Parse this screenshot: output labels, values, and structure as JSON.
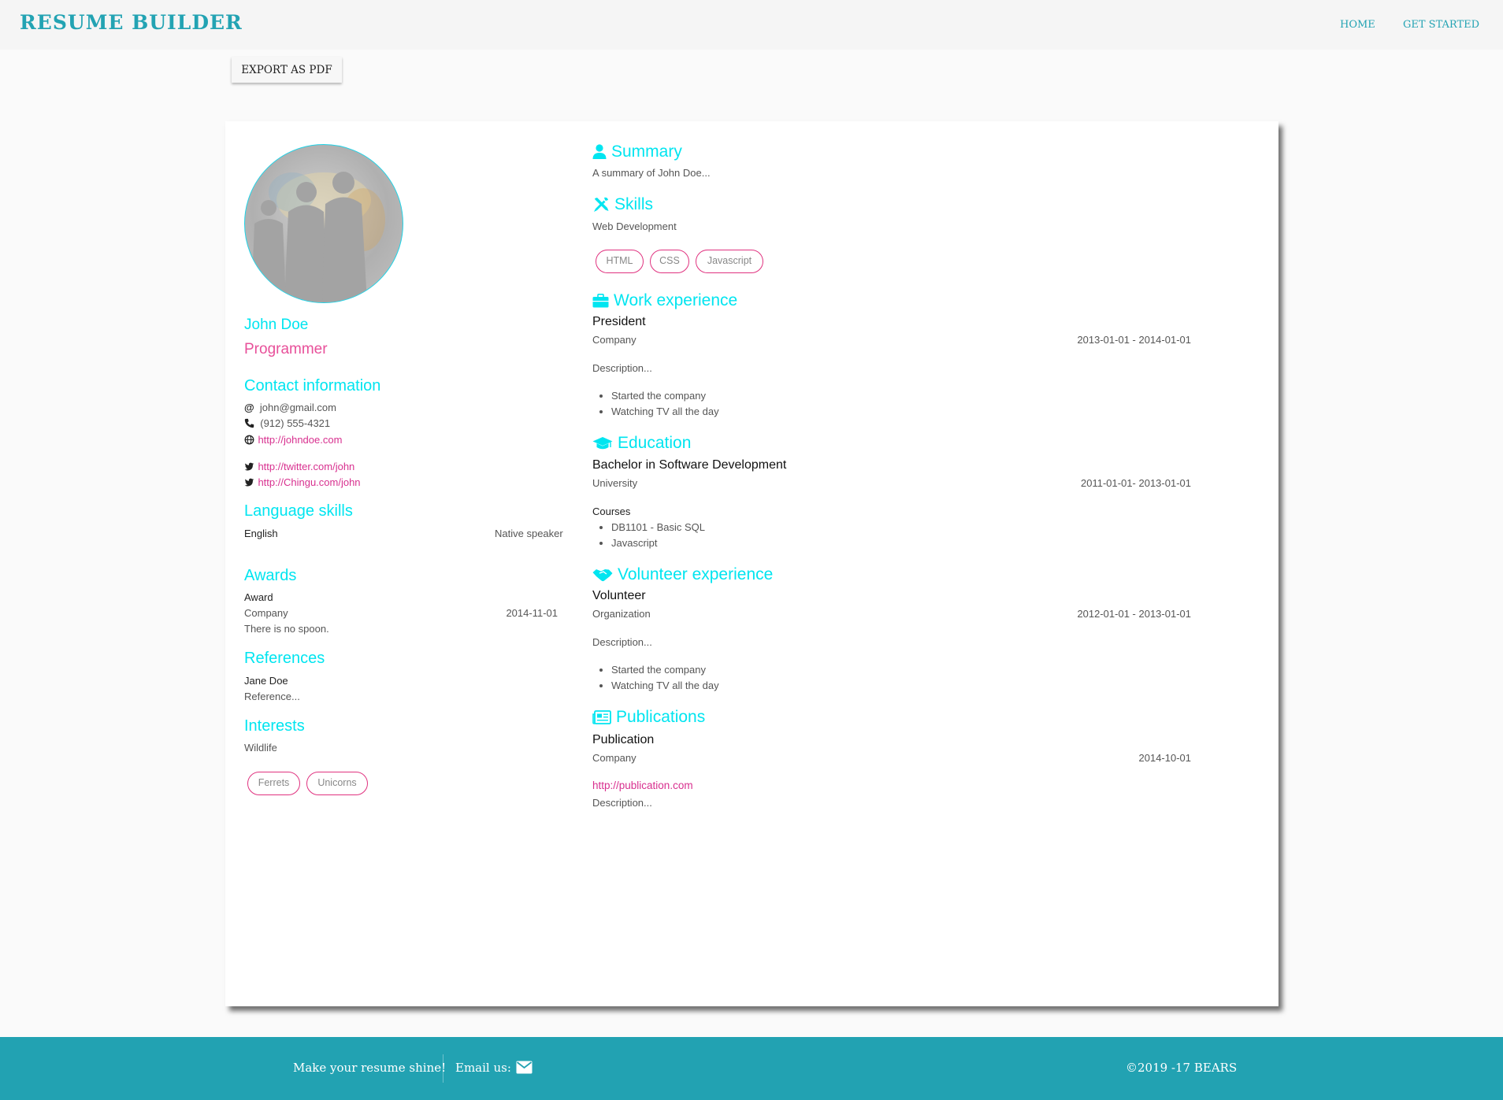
{
  "header": {
    "brand": "RESUME BUILDER",
    "nav": [
      {
        "label": "HOME"
      },
      {
        "label": "GET STARTED"
      }
    ]
  },
  "toolbar": {
    "export_label": "EXPORT AS PDF"
  },
  "resume": {
    "name": "John Doe",
    "role": "Programmer",
    "contact": {
      "heading": "Contact information",
      "email": "john@gmail.com",
      "phone": "(912) 555-4321",
      "website": "http://johndoe.com",
      "profiles": [
        "http://twitter.com/john",
        "http://Chingu.com/john"
      ]
    },
    "languages": {
      "heading": "Language skills",
      "items": [
        {
          "language": "English",
          "fluency": "Native speaker"
        }
      ]
    },
    "awards": {
      "heading": "Awards",
      "items": [
        {
          "title": "Award",
          "awarder": "Company",
          "date": "2014-11-01",
          "summary": "There is no spoon."
        }
      ]
    },
    "references": {
      "heading": "References",
      "items": [
        {
          "name": "Jane Doe",
          "reference": "Reference..."
        }
      ]
    },
    "interests": {
      "heading": "Interests",
      "items": [
        {
          "name": "Wildlife",
          "keywords": [
            "Ferrets",
            "Unicorns"
          ]
        }
      ]
    },
    "summary": {
      "heading": "Summary",
      "text": "A summary of John Doe..."
    },
    "skills": {
      "heading": "Skills",
      "items": [
        {
          "name": "Web Development",
          "keywords": [
            "HTML",
            "CSS",
            "Javascript"
          ]
        }
      ]
    },
    "work": {
      "heading": "Work experience",
      "items": [
        {
          "position": "President",
          "company": "Company",
          "dates": "2013-01-01 - 2014-01-01",
          "summary": "Description...",
          "highlights": [
            "Started the company",
            "Watching TV all the day"
          ]
        }
      ]
    },
    "education": {
      "heading": "Education",
      "items": [
        {
          "degree": "Bachelor in Software Development",
          "institution": "University",
          "dates": "2011-01-01- 2013-01-01",
          "courses_label": "Courses",
          "courses": [
            "DB1101 - Basic SQL",
            "Javascript"
          ]
        }
      ]
    },
    "volunteer": {
      "heading": "Volunteer experience",
      "items": [
        {
          "position": "Volunteer",
          "organization": "Organization",
          "dates": "2012-01-01 - 2013-01-01",
          "summary": "Description...",
          "highlights": [
            "Started the company",
            "Watching TV all the day"
          ]
        }
      ]
    },
    "publications": {
      "heading": "Publications",
      "items": [
        {
          "name": "Publication",
          "publisher": "Company",
          "date": "2014-10-01",
          "website": "http://publication.com",
          "summary": "Description..."
        }
      ]
    }
  },
  "footer": {
    "tagline": "Make your resume shine!",
    "email_label": "Email us:",
    "copyright": "©2019 -17 BEARS"
  },
  "colors": {
    "accent": "#00e5f0",
    "brand": "#23a3b3",
    "chip_border": "#e0327f",
    "link": "#d8308f",
    "footer_bg": "#22a2b2"
  },
  "icons": [
    "at-icon",
    "phone-icon",
    "globe-icon",
    "twitter-icon",
    "user-icon",
    "tools-icon",
    "briefcase-icon",
    "graduation-cap-icon",
    "handshake-icon",
    "newspaper-icon",
    "envelope-icon"
  ]
}
